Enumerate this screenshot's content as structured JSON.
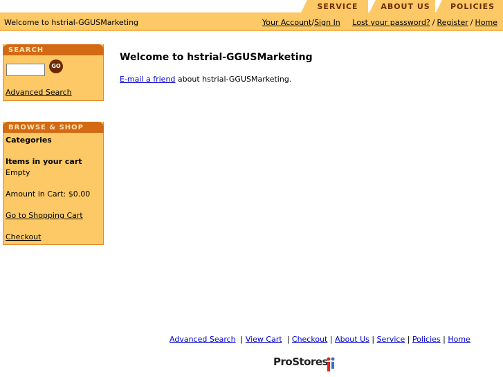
{
  "tabs": [
    {
      "label": "SERVICE"
    },
    {
      "label": "ABOUT US"
    },
    {
      "label": "POLICIES"
    }
  ],
  "header": {
    "welcome": "Welcome to hstrial-GGUSMarketing",
    "your_account": "Your Account",
    "sign_in": "Sign In",
    "lost_password": "Lost your password?",
    "register": "Register",
    "home": "Home",
    "slash": "/"
  },
  "search": {
    "heading": "SEARCH",
    "input_value": "",
    "go_label": "GO",
    "advanced_search": "Advanced Search"
  },
  "browse": {
    "heading": "BROWSE & SHOP",
    "categories": "Categories",
    "items_in_cart": "Items in your cart",
    "cart_status": "Empty",
    "amount": "Amount in Cart: $0.00",
    "go_to_cart": "Go to Shopping Cart",
    "checkout": "Checkout"
  },
  "main": {
    "title": "Welcome to hstrial-GGUSMarketing",
    "email_link": "E-mail a friend",
    "email_text": " about hstrial-GGUSMarketing."
  },
  "footer": {
    "links": [
      "Advanced Search",
      "View Cart",
      "Checkout",
      "About Us",
      "Service",
      "Policies",
      "Home"
    ],
    "logo": "ProStores"
  },
  "colors": {
    "bar": "#fcc966",
    "box_head": "#d36a13",
    "tab_text": "#6b2b00"
  }
}
